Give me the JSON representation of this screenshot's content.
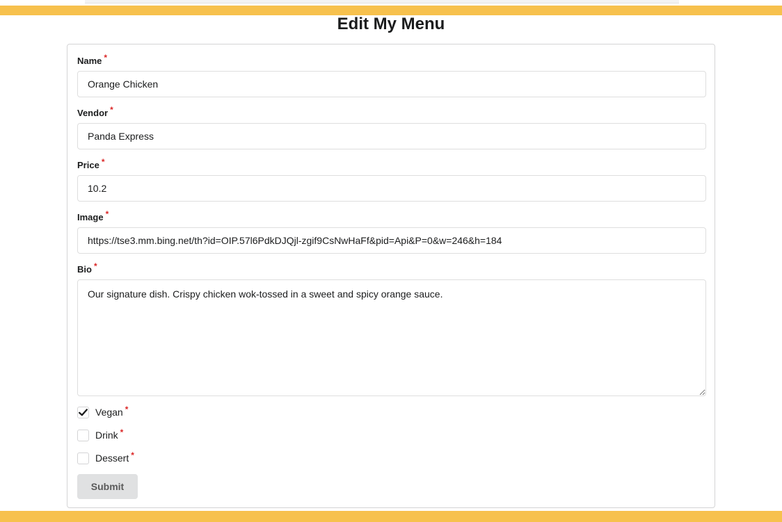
{
  "page": {
    "title": "Edit My Menu",
    "required_mark": "*"
  },
  "form": {
    "name": {
      "label": "Name",
      "value": "Orange Chicken"
    },
    "vendor": {
      "label": "Vendor",
      "value": "Panda Express"
    },
    "price": {
      "label": "Price",
      "value": "10.2"
    },
    "image": {
      "label": "Image",
      "value": "https://tse3.mm.bing.net/th?id=OIP.57l6PdkDJQjl-zgif9CsNwHaFf&pid=Api&P=0&w=246&h=184"
    },
    "bio": {
      "label": "Bio",
      "value": "Our signature dish. Crispy chicken wok-tossed in a sweet and spicy orange sauce."
    },
    "vegan": {
      "label": "Vegan",
      "checked": true
    },
    "drink": {
      "label": "Drink",
      "checked": false
    },
    "dessert": {
      "label": "Dessert",
      "checked": false
    },
    "submit_label": "Submit"
  },
  "colors": {
    "accent_bar": "#f7c14d",
    "required": "#db2828",
    "button_bg": "#e0e1e2"
  }
}
